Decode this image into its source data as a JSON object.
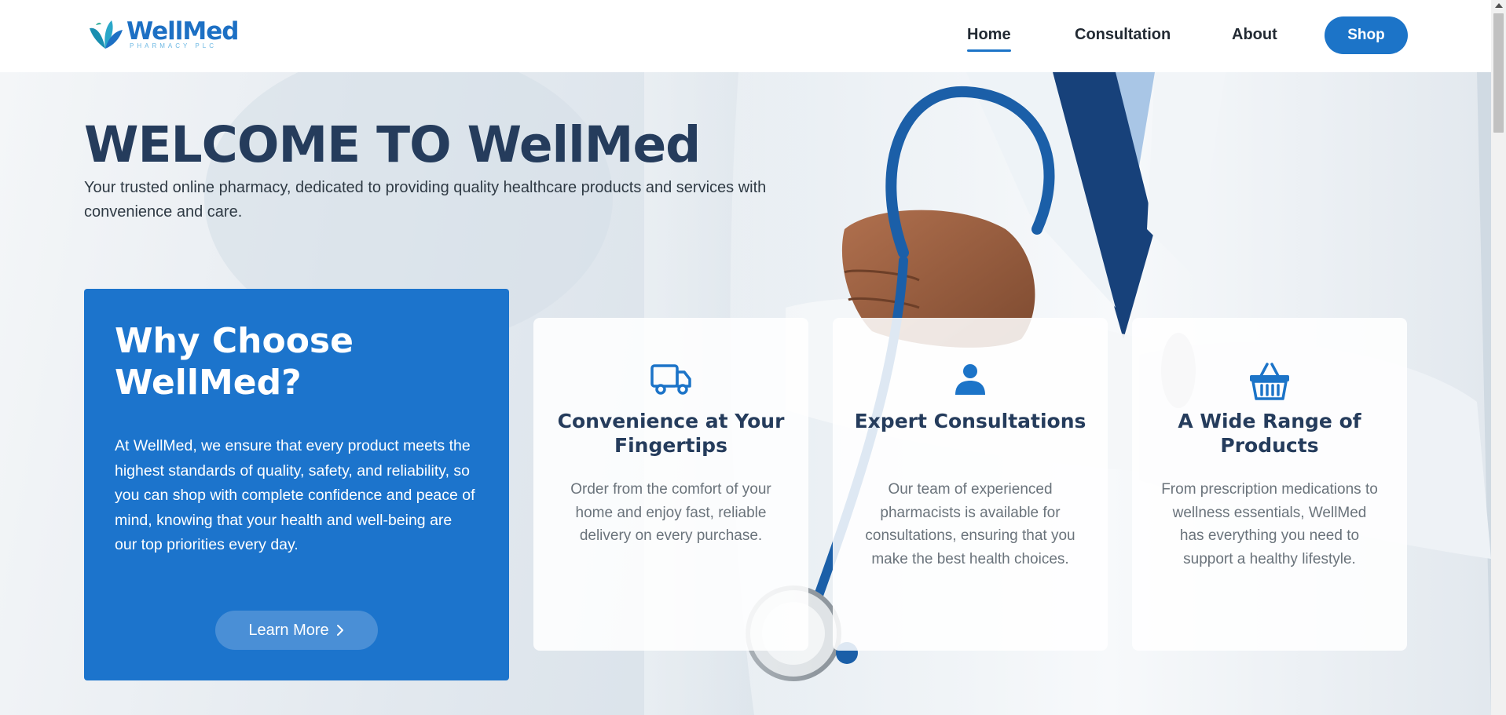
{
  "brand": {
    "name": "WellMed",
    "tagline": "PHARMACY PLC",
    "accent": "#1c74c8",
    "logo_icon": "leaf-logo-icon"
  },
  "nav": {
    "links": [
      {
        "label": "Home",
        "active": true
      },
      {
        "label": "Consultation",
        "active": false
      },
      {
        "label": "About",
        "active": false
      }
    ],
    "shop_label": "Shop"
  },
  "hero": {
    "title": "WELCOME TO WellMed",
    "subtitle": "Your trusted online pharmacy, dedicated to providing quality healthcare products and services with convenience and care."
  },
  "why": {
    "title": "Why Choose WellMed?",
    "body": "At WellMed, we ensure that every product meets the highest standards of quality, safety, and reliability, so you can shop with complete confidence and peace of mind, knowing that your health and well-being are our top priorities every day.",
    "button_label": "Learn More",
    "button_icon": "chevron-right-icon"
  },
  "features": [
    {
      "icon": "truck-icon",
      "title": "Convenience at Your Fingertips",
      "text": "Order from the comfort of your home and enjoy fast, reliable delivery on every purchase."
    },
    {
      "icon": "user-icon",
      "title": "Expert Consultations",
      "text": "Our team of experienced pharmacists is available for consultations, ensuring that you make the best health choices."
    },
    {
      "icon": "basket-icon",
      "title": "A Wide Range of Products",
      "text": "From prescription medications to wellness essentials, WellMed has everything you need to support a healthy lifestyle."
    }
  ]
}
